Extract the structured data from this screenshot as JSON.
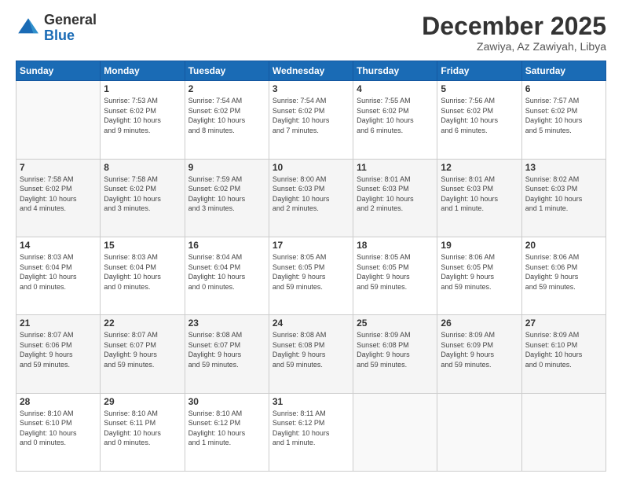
{
  "header": {
    "logo_line1": "General",
    "logo_line2": "Blue",
    "month": "December 2025",
    "location": "Zawiya, Az Zawiyah, Libya"
  },
  "weekdays": [
    "Sunday",
    "Monday",
    "Tuesday",
    "Wednesday",
    "Thursday",
    "Friday",
    "Saturday"
  ],
  "rows": [
    [
      {
        "day": "",
        "info": ""
      },
      {
        "day": "1",
        "info": "Sunrise: 7:53 AM\nSunset: 6:02 PM\nDaylight: 10 hours\nand 9 minutes."
      },
      {
        "day": "2",
        "info": "Sunrise: 7:54 AM\nSunset: 6:02 PM\nDaylight: 10 hours\nand 8 minutes."
      },
      {
        "day": "3",
        "info": "Sunrise: 7:54 AM\nSunset: 6:02 PM\nDaylight: 10 hours\nand 7 minutes."
      },
      {
        "day": "4",
        "info": "Sunrise: 7:55 AM\nSunset: 6:02 PM\nDaylight: 10 hours\nand 6 minutes."
      },
      {
        "day": "5",
        "info": "Sunrise: 7:56 AM\nSunset: 6:02 PM\nDaylight: 10 hours\nand 6 minutes."
      },
      {
        "day": "6",
        "info": "Sunrise: 7:57 AM\nSunset: 6:02 PM\nDaylight: 10 hours\nand 5 minutes."
      }
    ],
    [
      {
        "day": "7",
        "info": "Sunrise: 7:58 AM\nSunset: 6:02 PM\nDaylight: 10 hours\nand 4 minutes."
      },
      {
        "day": "8",
        "info": "Sunrise: 7:58 AM\nSunset: 6:02 PM\nDaylight: 10 hours\nand 3 minutes."
      },
      {
        "day": "9",
        "info": "Sunrise: 7:59 AM\nSunset: 6:02 PM\nDaylight: 10 hours\nand 3 minutes."
      },
      {
        "day": "10",
        "info": "Sunrise: 8:00 AM\nSunset: 6:03 PM\nDaylight: 10 hours\nand 2 minutes."
      },
      {
        "day": "11",
        "info": "Sunrise: 8:01 AM\nSunset: 6:03 PM\nDaylight: 10 hours\nand 2 minutes."
      },
      {
        "day": "12",
        "info": "Sunrise: 8:01 AM\nSunset: 6:03 PM\nDaylight: 10 hours\nand 1 minute."
      },
      {
        "day": "13",
        "info": "Sunrise: 8:02 AM\nSunset: 6:03 PM\nDaylight: 10 hours\nand 1 minute."
      }
    ],
    [
      {
        "day": "14",
        "info": "Sunrise: 8:03 AM\nSunset: 6:04 PM\nDaylight: 10 hours\nand 0 minutes."
      },
      {
        "day": "15",
        "info": "Sunrise: 8:03 AM\nSunset: 6:04 PM\nDaylight: 10 hours\nand 0 minutes."
      },
      {
        "day": "16",
        "info": "Sunrise: 8:04 AM\nSunset: 6:04 PM\nDaylight: 10 hours\nand 0 minutes."
      },
      {
        "day": "17",
        "info": "Sunrise: 8:05 AM\nSunset: 6:05 PM\nDaylight: 9 hours\nand 59 minutes."
      },
      {
        "day": "18",
        "info": "Sunrise: 8:05 AM\nSunset: 6:05 PM\nDaylight: 9 hours\nand 59 minutes."
      },
      {
        "day": "19",
        "info": "Sunrise: 8:06 AM\nSunset: 6:05 PM\nDaylight: 9 hours\nand 59 minutes."
      },
      {
        "day": "20",
        "info": "Sunrise: 8:06 AM\nSunset: 6:06 PM\nDaylight: 9 hours\nand 59 minutes."
      }
    ],
    [
      {
        "day": "21",
        "info": "Sunrise: 8:07 AM\nSunset: 6:06 PM\nDaylight: 9 hours\nand 59 minutes."
      },
      {
        "day": "22",
        "info": "Sunrise: 8:07 AM\nSunset: 6:07 PM\nDaylight: 9 hours\nand 59 minutes."
      },
      {
        "day": "23",
        "info": "Sunrise: 8:08 AM\nSunset: 6:07 PM\nDaylight: 9 hours\nand 59 minutes."
      },
      {
        "day": "24",
        "info": "Sunrise: 8:08 AM\nSunset: 6:08 PM\nDaylight: 9 hours\nand 59 minutes."
      },
      {
        "day": "25",
        "info": "Sunrise: 8:09 AM\nSunset: 6:08 PM\nDaylight: 9 hours\nand 59 minutes."
      },
      {
        "day": "26",
        "info": "Sunrise: 8:09 AM\nSunset: 6:09 PM\nDaylight: 9 hours\nand 59 minutes."
      },
      {
        "day": "27",
        "info": "Sunrise: 8:09 AM\nSunset: 6:10 PM\nDaylight: 10 hours\nand 0 minutes."
      }
    ],
    [
      {
        "day": "28",
        "info": "Sunrise: 8:10 AM\nSunset: 6:10 PM\nDaylight: 10 hours\nand 0 minutes."
      },
      {
        "day": "29",
        "info": "Sunrise: 8:10 AM\nSunset: 6:11 PM\nDaylight: 10 hours\nand 0 minutes."
      },
      {
        "day": "30",
        "info": "Sunrise: 8:10 AM\nSunset: 6:12 PM\nDaylight: 10 hours\nand 1 minute."
      },
      {
        "day": "31",
        "info": "Sunrise: 8:11 AM\nSunset: 6:12 PM\nDaylight: 10 hours\nand 1 minute."
      },
      {
        "day": "",
        "info": ""
      },
      {
        "day": "",
        "info": ""
      },
      {
        "day": "",
        "info": ""
      }
    ]
  ]
}
